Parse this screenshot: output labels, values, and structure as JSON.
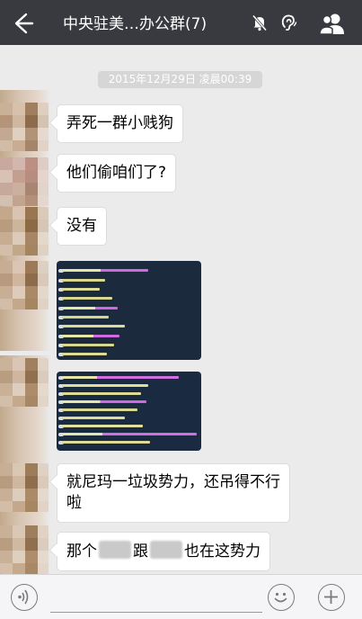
{
  "topbar": {
    "title": "中央驻美…办公群(7)",
    "icons": [
      "back-arrow-icon",
      "bell-muted-icon",
      "earpiece-icon",
      "group-members-icon"
    ]
  },
  "chat": {
    "timestamp": "2015年12月29日 凌晨00:39",
    "messages": [
      {
        "type": "text",
        "text": "弄死一群小贱狗"
      },
      {
        "type": "text",
        "text": "他们偷咱们了?"
      },
      {
        "type": "text",
        "text": "没有"
      },
      {
        "type": "image",
        "description_icon": "chat-log-screenshot"
      },
      {
        "type": "image",
        "description_icon": "chat-log-screenshot"
      },
      {
        "type": "text",
        "text": "就尼玛一垃圾势力，还吊得不行啦"
      },
      {
        "type": "text_redacted",
        "part1": "那个",
        "part2": "跟",
        "part3": "也在这势力"
      }
    ]
  },
  "inputbar": {
    "placeholder": "",
    "icons": [
      "voice-icon",
      "emoji-icon",
      "plus-icon"
    ]
  },
  "colors": {
    "topbar_bg": "#393a3f",
    "chat_bg": "#ebebeb",
    "bubble_bg": "#ffffff"
  }
}
